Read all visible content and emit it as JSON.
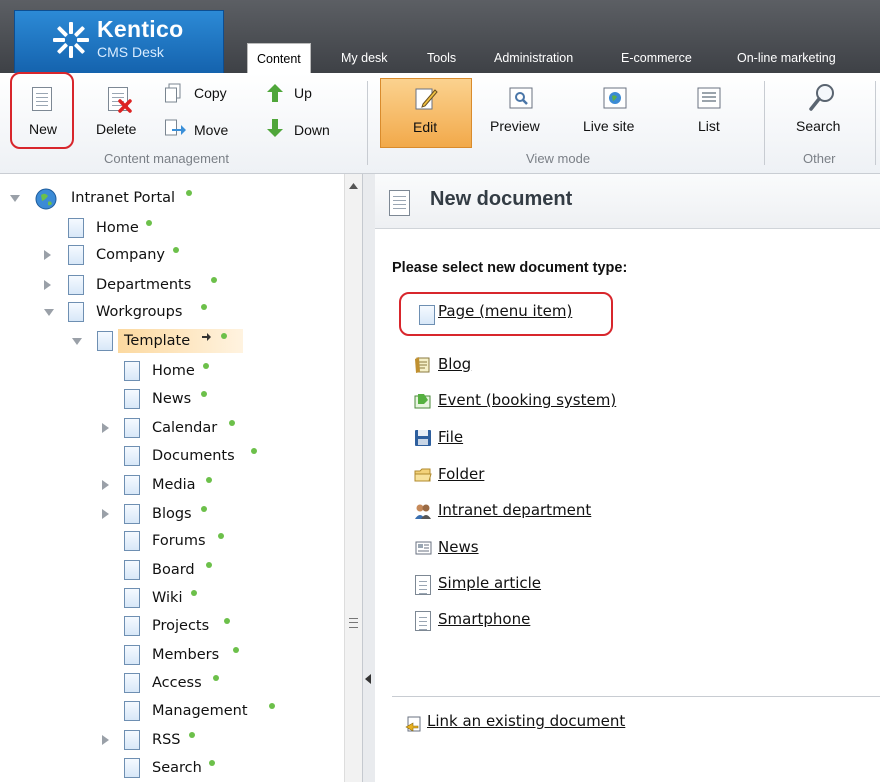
{
  "app": {
    "brand": "Kentico",
    "product": "CMS Desk"
  },
  "tabs": [
    {
      "label": "Content",
      "active": true
    },
    {
      "label": "My desk"
    },
    {
      "label": "Tools"
    },
    {
      "label": "Administration"
    },
    {
      "label": "E-commerce"
    },
    {
      "label": "On-line marketing"
    }
  ],
  "ribbon": {
    "content_management": {
      "group_label": "Content management",
      "new": "New",
      "delete": "Delete",
      "copy": "Copy",
      "move": "Move",
      "up": "Up",
      "down": "Down"
    },
    "view_mode": {
      "group_label": "View mode",
      "edit": "Edit",
      "preview": "Preview",
      "live_site": "Live site",
      "list": "List"
    },
    "other": {
      "group_label": "Other",
      "search": "Search"
    }
  },
  "tree": {
    "root": "Intranet Portal",
    "items": [
      "Home",
      "Company",
      "Departments",
      "Workgroups",
      "Template"
    ],
    "template_children": [
      "Home",
      "News",
      "Calendar",
      "Documents",
      "Media",
      "Blogs",
      "Forums",
      "Board",
      "Wiki",
      "Projects",
      "Members",
      "Access",
      "Management",
      "RSS",
      "Search"
    ]
  },
  "main": {
    "title": "New document",
    "prompt": "Please select new document type:",
    "types": [
      {
        "label": "Page (menu item)",
        "icon": "page-icon"
      },
      {
        "label": "Blog",
        "icon": "blog-icon"
      },
      {
        "label": "Event (booking system)",
        "icon": "event-icon"
      },
      {
        "label": "File",
        "icon": "file-disk-icon"
      },
      {
        "label": "Folder",
        "icon": "folder-icon"
      },
      {
        "label": "Intranet department",
        "icon": "department-icon"
      },
      {
        "label": "News",
        "icon": "news-icon"
      },
      {
        "label": "Simple article",
        "icon": "article-icon"
      },
      {
        "label": "Smartphone",
        "icon": "smartphone-icon"
      }
    ],
    "link_existing": "Link an existing document"
  },
  "colors": {
    "highlight": "#d8262c",
    "status_dot": "#6cc04a",
    "selected_node": "#fde3b8",
    "active_view": "#f7b556"
  }
}
